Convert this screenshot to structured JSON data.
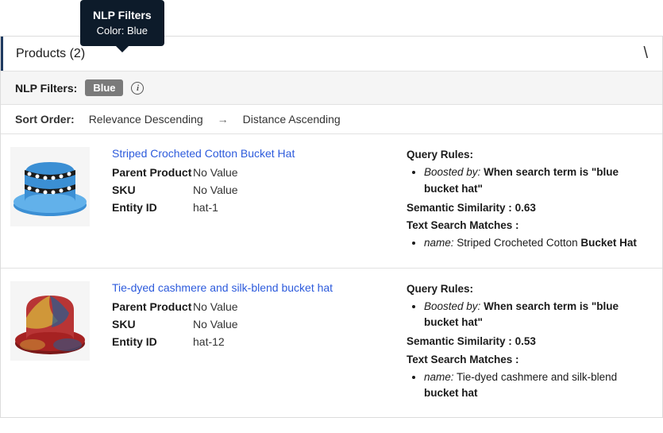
{
  "tooltip": {
    "title": "NLP Filters",
    "colorLabel": "Color:",
    "colorValue": "Blue"
  },
  "panel": {
    "title": "Products (2)"
  },
  "filters": {
    "label": "NLP Filters:",
    "chip": "Blue",
    "info": "i"
  },
  "sort": {
    "label": "Sort Order:",
    "primary": "Relevance Descending",
    "arrow": "→",
    "secondary": "Distance Ascending"
  },
  "fieldLabels": {
    "parent": "Parent Product",
    "sku": "SKU",
    "entity": "Entity ID"
  },
  "explainLabels": {
    "queryRules": "Query Rules:",
    "boostedBy": "Boosted by:",
    "similarityPrefix": "Semantic Similarity : ",
    "matches": "Text Search Matches :",
    "nameField": "name:"
  },
  "results": [
    {
      "title": "Striped Crocheted Cotton Bucket Hat",
      "parent": "No Value",
      "sku": "No Value",
      "entityId": "hat-1",
      "boostRule": "When search term is \"blue bucket hat\"",
      "similarity": "0.63",
      "matchPrefix": "Striped Crocheted Cotton ",
      "matchBold": "Bucket Hat"
    },
    {
      "title": "Tie-dyed cashmere and silk-blend bucket hat",
      "parent": "No Value",
      "sku": "No Value",
      "entityId": "hat-12",
      "boostRule": "When search term is \"blue bucket hat\"",
      "similarity": "0.53",
      "matchPrefix": "Tie-dyed cashmere and silk-blend ",
      "matchBold": "bucket hat"
    }
  ]
}
